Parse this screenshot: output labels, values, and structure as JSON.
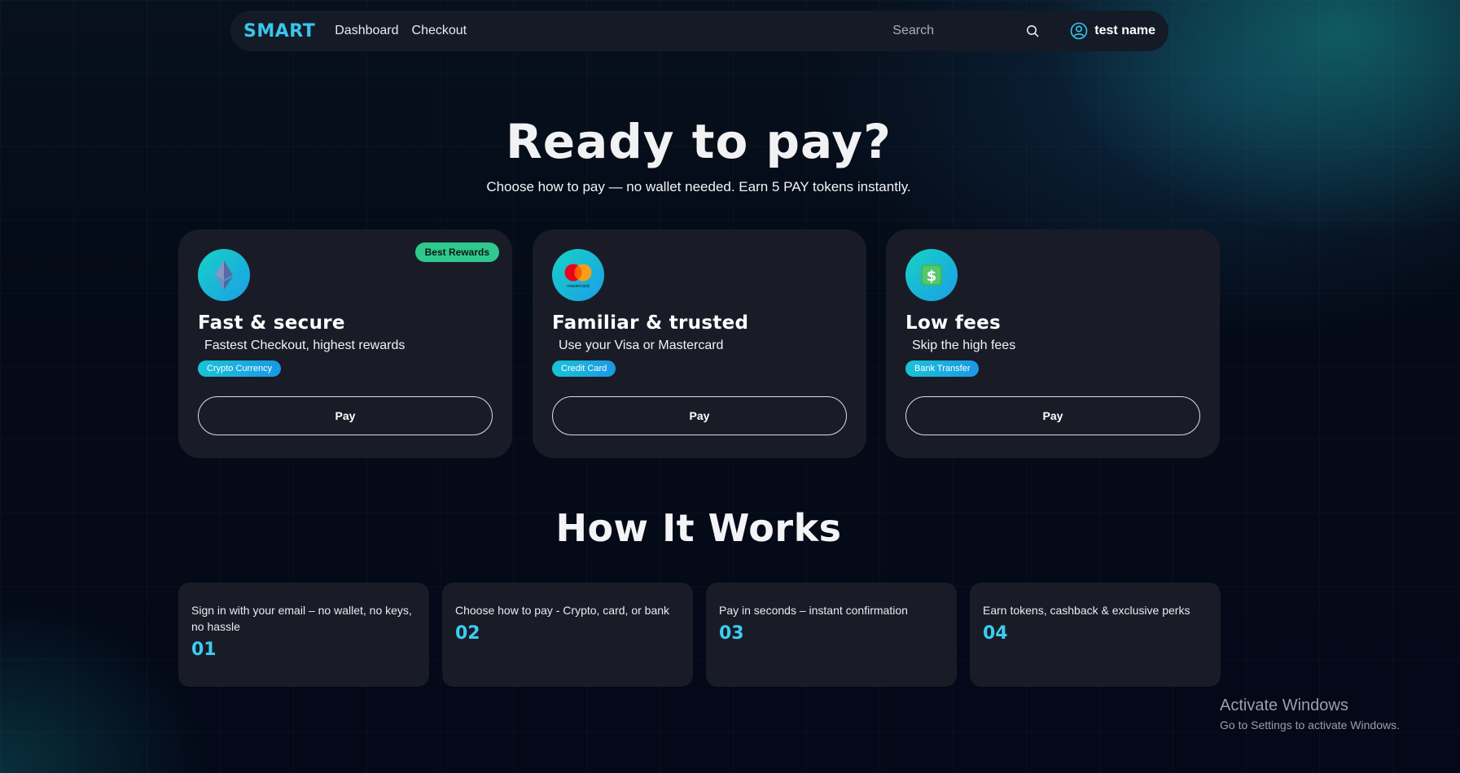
{
  "navbar": {
    "logo": "SMART",
    "links": [
      "Dashboard",
      "Checkout"
    ],
    "search_placeholder": "Search",
    "user_name": "test name"
  },
  "hero": {
    "title": "Ready to pay?",
    "subtitle": "Choose how to pay — no wallet needed. Earn 5 PAY tokens instantly."
  },
  "payment_options": [
    {
      "icon": "ethereum-icon",
      "badge": "Best Rewards",
      "title": "Fast & secure",
      "description": "Fastest Checkout, highest rewards",
      "tag": "Crypto Currency",
      "button": "Pay"
    },
    {
      "icon": "mastercard-icon",
      "title": "Familiar & trusted",
      "description": "Use your Visa or Mastercard",
      "tag": "Credit Card",
      "button": "Pay",
      "icon_text": "mastercard"
    },
    {
      "icon": "dollar-bill-icon",
      "title": "Low fees",
      "description": "Skip the high fees",
      "tag": "Bank Transfer",
      "button": "Pay"
    }
  ],
  "how_it_works": {
    "title": "How It Works",
    "steps": [
      {
        "text": "Sign in with your email – no wallet, no keys, no hassle",
        "number": "01"
      },
      {
        "text": "Choose how to pay - Crypto, card, or bank",
        "number": "02"
      },
      {
        "text": "Pay in seconds – instant confirmation",
        "number": "03"
      },
      {
        "text": "Earn tokens, cashback & exclusive perks",
        "number": "04"
      }
    ]
  },
  "watermark": {
    "title": "Activate Windows",
    "subtitle": "Go to Settings to activate Windows."
  },
  "colors": {
    "accent": "#39c6ee",
    "badge": "#2fc88d",
    "card_bg": "#191c27",
    "page_bg": "#040a17"
  }
}
